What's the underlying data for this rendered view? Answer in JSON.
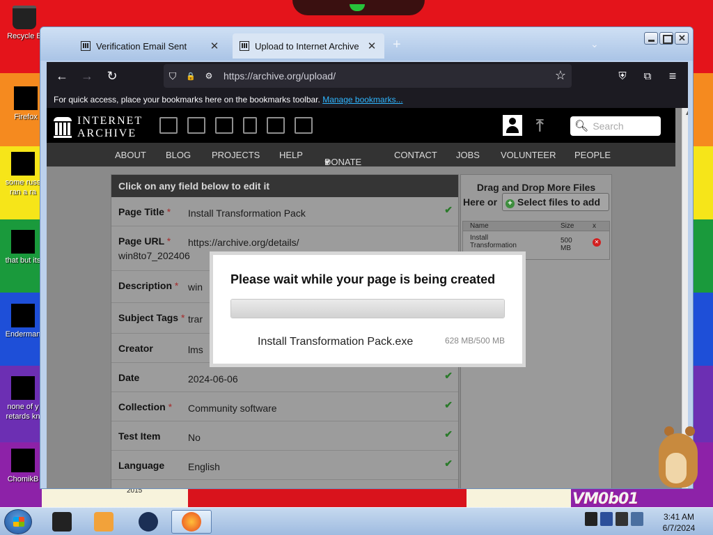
{
  "desktop": {
    "icons": [
      {
        "label": "Recycle B"
      },
      {
        "label": "Firefox"
      },
      {
        "label": "some russ ran a ra"
      },
      {
        "label": "that but its"
      },
      {
        "label": "Enderman"
      },
      {
        "label": "none of y retards kn"
      },
      {
        "label": "ChomikB"
      }
    ],
    "wallpaper_text": "VM0b01",
    "wallpaper_small": "2015"
  },
  "browser": {
    "tabs": [
      {
        "label": "Verification Email Sent",
        "close": "✕"
      },
      {
        "label": "Upload to Internet Archive",
        "close": "✕"
      }
    ],
    "new_tab": "+",
    "tab_list": "⌄",
    "url": "https://archive.org/upload/",
    "bookmarks_hint": "For quick access, place your bookmarks here on the bookmarks toolbar.",
    "bookmarks_link": "Manage bookmarks...",
    "nav_icons": {
      "back": "←",
      "forward": "→",
      "reload": "↻",
      "shield": "⛉",
      "lock": "🔒",
      "perm": "⚙",
      "star": "☆",
      "pocket": "⛨",
      "extensions": "⧉",
      "menu": "≡"
    }
  },
  "archive": {
    "logo_line1": "INTERNET",
    "logo_line2": "ARCHIVE",
    "search_placeholder": "Search",
    "nav": [
      "ABOUT",
      "BLOG",
      "PROJECTS",
      "HELP",
      "DONATE",
      "CONTACT",
      "JOBS",
      "VOLUNTEER",
      "PEOPLE"
    ],
    "donate_heart": "♥",
    "form": {
      "header": "Click on any field below to edit it",
      "rows": [
        {
          "label": "Page Title",
          "required": true,
          "value": "Install Transformation Pack",
          "check": "✔"
        },
        {
          "label": "Page URL",
          "required": true,
          "value": "https://archive.org/details/",
          "value2": "win8to7_202406",
          "check": ""
        },
        {
          "label": "Description",
          "required": true,
          "value": "win",
          "check": ""
        },
        {
          "label": "Subject Tags",
          "required": true,
          "value": "trar",
          "check": ""
        },
        {
          "label": "Creator",
          "required": false,
          "value": "lms",
          "check": ""
        },
        {
          "label": "Date",
          "required": false,
          "value": "2024-06-06",
          "check": "✔"
        },
        {
          "label": "Collection",
          "required": true,
          "value": "Community software",
          "check": "✔"
        },
        {
          "label": "Test Item",
          "required": false,
          "value": "No",
          "check": "✔"
        },
        {
          "label": "Language",
          "required": false,
          "value": "English",
          "check": "✔"
        }
      ],
      "required_mark": "*"
    },
    "dropzone": {
      "title": "Drag and Drop More Files",
      "here_or": "Here or",
      "select_button": "Select files to add",
      "columns": [
        "Name",
        "Size",
        "x"
      ],
      "file": {
        "name": "Install Transformation",
        "size": "500 MB",
        "remove": "✕"
      }
    },
    "modal": {
      "title": "Please wait while your page is being created",
      "filename": "Install Transformation Pack.exe",
      "size": "628 MB/500 MB",
      "progress": 1.0
    }
  },
  "taskbar": {
    "time": "3:41 AM",
    "date": "6/7/2024"
  }
}
